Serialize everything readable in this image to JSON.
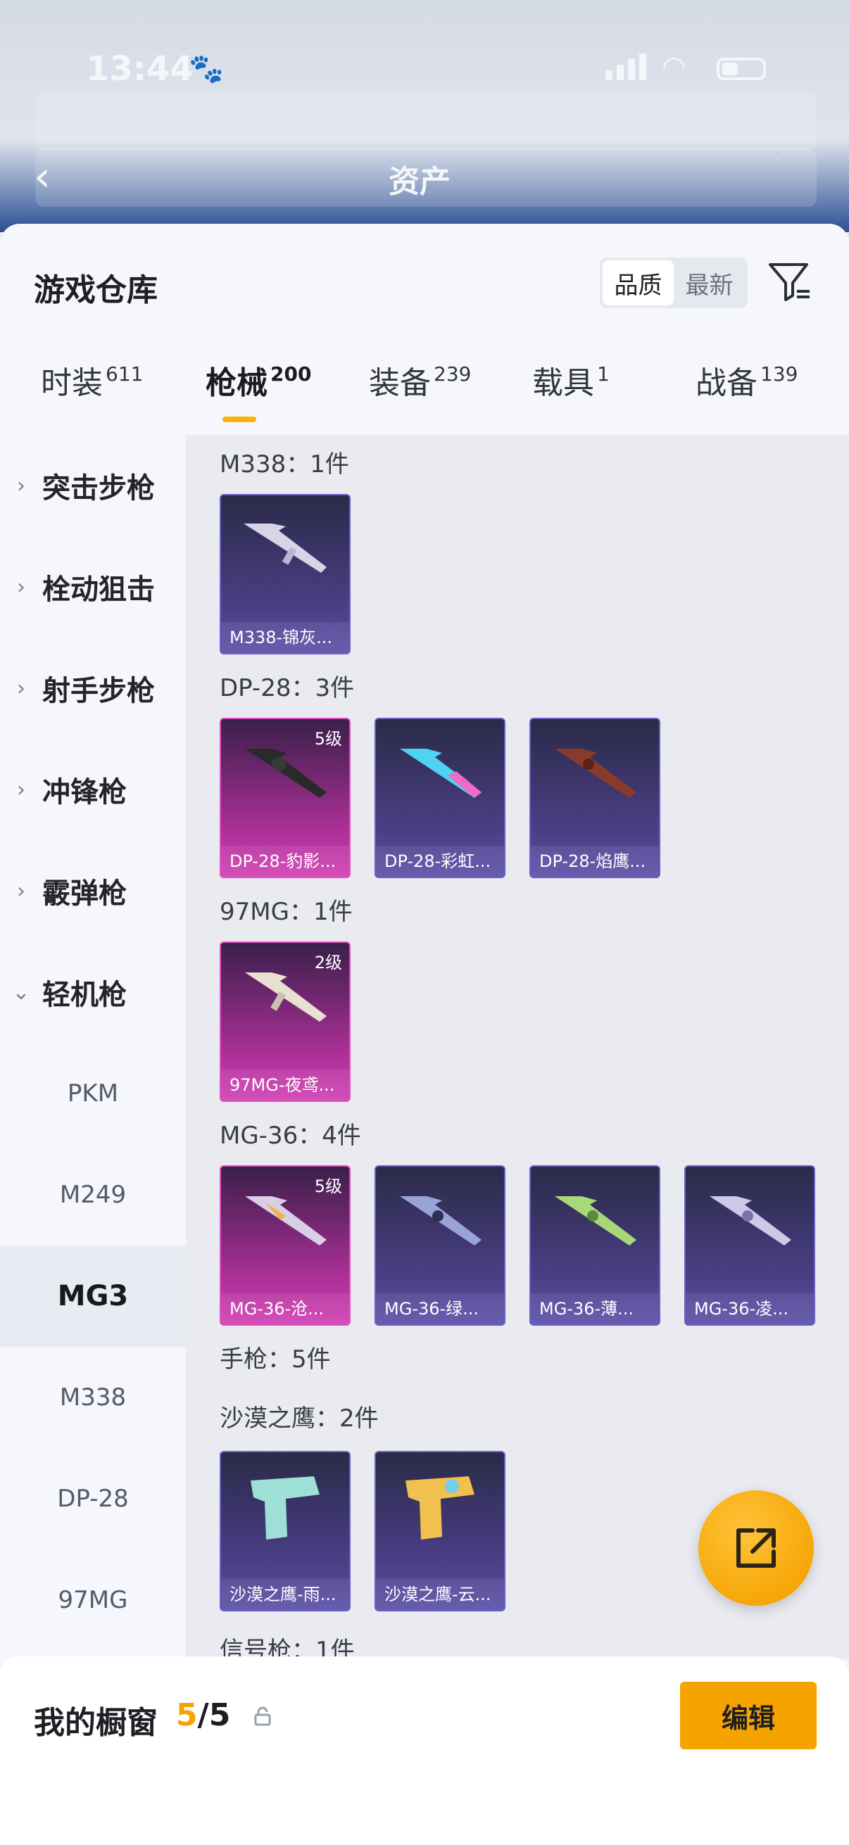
{
  "status_bar": {
    "time": "13:44"
  },
  "header": {
    "title": "资产",
    "back_icon": "chevron-left-icon"
  },
  "sheet": {
    "title": "游戏仓库",
    "sort": {
      "options": [
        "品质",
        "最新"
      ],
      "selected": "品质"
    },
    "filter_icon": "filter-icon"
  },
  "tabs": [
    {
      "label": "时装",
      "count": "611"
    },
    {
      "label": "枪械",
      "count": "200",
      "active": true
    },
    {
      "label": "装备",
      "count": "239"
    },
    {
      "label": "载具",
      "count": "1"
    },
    {
      "label": "战备",
      "count": "139"
    }
  ],
  "categories": [
    {
      "label": "突击步枪"
    },
    {
      "label": "栓动狙击"
    },
    {
      "label": "射手步枪"
    },
    {
      "label": "冲锋枪"
    },
    {
      "label": "霰弹枪"
    },
    {
      "label": "轻机枪",
      "expanded": true
    }
  ],
  "subcategories": [
    "PKM",
    "M249",
    "MG3",
    "M338",
    "DP-28",
    "97MG"
  ],
  "selected_subcategory": "MG3",
  "groups": [
    {
      "title": "M338：1件",
      "items": [
        {
          "name": "M338-锦灰...",
          "rarity": "purple"
        }
      ]
    },
    {
      "title": "DP-28：3件",
      "items": [
        {
          "name": "DP-28-豹影...",
          "rarity": "pink",
          "level": "5级"
        },
        {
          "name": "DP-28-彩虹...",
          "rarity": "purple"
        },
        {
          "name": "DP-28-焰鹰...",
          "rarity": "purple"
        }
      ]
    },
    {
      "title": "97MG：1件",
      "items": [
        {
          "name": "97MG-夜鸢...",
          "rarity": "pink",
          "level": "2级"
        }
      ]
    },
    {
      "title": "MG-36：4件",
      "items": [
        {
          "name": "MG-36-沧...",
          "rarity": "pink",
          "level": "5级"
        },
        {
          "name": "MG-36-绿...",
          "rarity": "purple"
        },
        {
          "name": "MG-36-薄...",
          "rarity": "purple"
        },
        {
          "name": "MG-36-凌...",
          "rarity": "purple"
        }
      ]
    },
    {
      "title": "手枪：5件",
      "items": []
    },
    {
      "title": "沙漠之鹰：2件",
      "items": [
        {
          "name": "沙漠之鹰-雨...",
          "rarity": "purple"
        },
        {
          "name": "沙漠之鹰-云...",
          "rarity": "purple"
        }
      ]
    },
    {
      "title": "信号枪：1件",
      "items": []
    }
  ],
  "fab": {
    "icon": "share-icon"
  },
  "bottom": {
    "label": "我的橱窗",
    "current": "5",
    "total": "/5",
    "lock_icon": "lock-icon",
    "edit_label": "编辑"
  },
  "colors": {
    "accent": "#f5a300",
    "purple_card": "#4a3f86",
    "pink_card": "#b3319c"
  }
}
